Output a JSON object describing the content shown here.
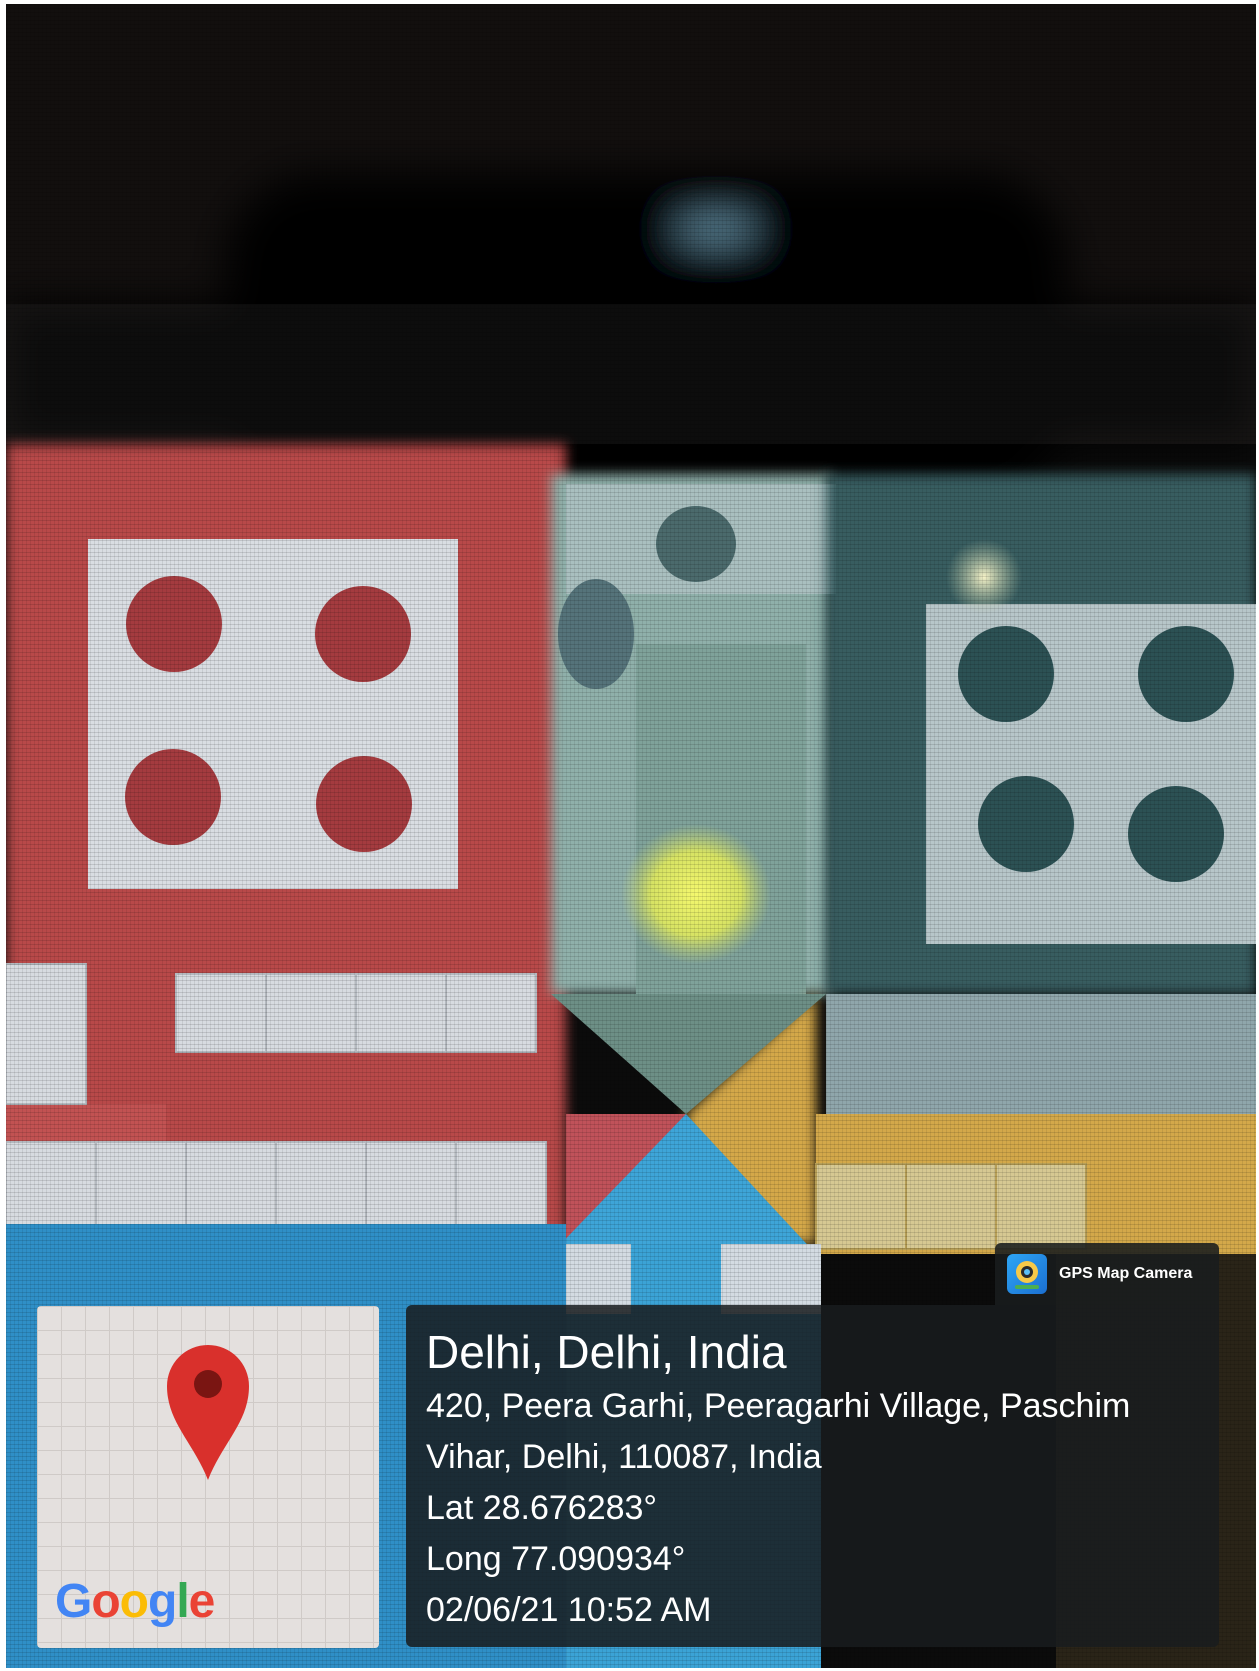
{
  "photo": {
    "colors": {
      "background": "#0b0b0b",
      "red_area": "#b84a4a",
      "board_white": "#d8dde2",
      "teal_area": "#5b8e92",
      "blue_area": "#3fa6d6",
      "yellow_area": "#d2a845",
      "yellow_glow": "#eef36a"
    }
  },
  "minimap": {
    "icon": "map-pin-icon",
    "pin_color": "#d9302c",
    "logo": {
      "letters": [
        "G",
        "o",
        "o",
        "g",
        "l",
        "e"
      ],
      "colors": [
        "#4285f4",
        "#ea4335",
        "#fbbc05",
        "#4285f4",
        "#34a853",
        "#ea4335"
      ]
    }
  },
  "badge": {
    "icon": "gps-map-camera-icon",
    "label": "GPS Map Camera"
  },
  "info": {
    "city": "Delhi, Delhi, India",
    "address_line1": "420, Peera Garhi, Peeragarhi Village, Paschim",
    "address_line2": "Vihar, Delhi, 110087, India",
    "lat": "Lat 28.676283°",
    "long": "Long 77.090934°",
    "datetime": "02/06/21 10:52 AM"
  }
}
